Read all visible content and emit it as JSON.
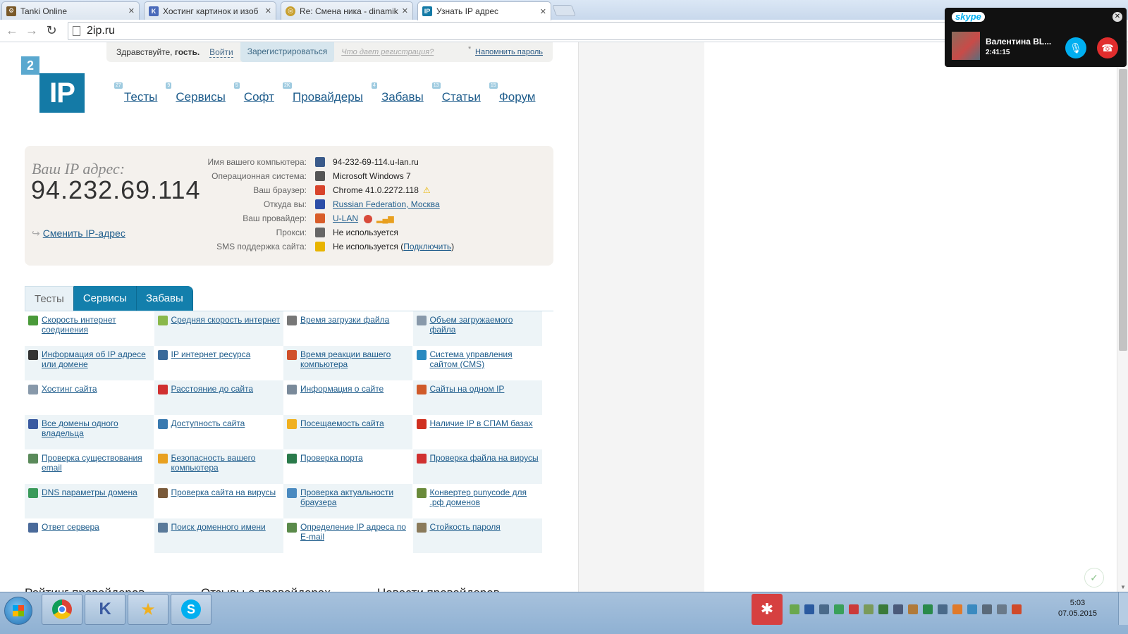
{
  "browser": {
    "tabs": [
      {
        "title": "Tanki Online",
        "icon": "tanki-icon",
        "color": "#7a5a2a"
      },
      {
        "title": "Хостинг картинок и изоб",
        "icon": "hosting-k-icon",
        "color": "#4a6aba"
      },
      {
        "title": "Re: Смена ника - dinamik",
        "icon": "forum-icon",
        "color": "#c8a030"
      },
      {
        "title": "Узнать IP адрес",
        "icon": "ip-favicon",
        "color": "#147aa6"
      }
    ],
    "url": "2ip.ru"
  },
  "site": {
    "greeting_prefix": "Здравствуйте,",
    "greeting_name": "гость.",
    "login": "Войти",
    "register": "Зарегистрироваться",
    "what_register": "Что дает регистрация?",
    "remind": "Напомнить пароль",
    "logo_small": "2",
    "logo_big": "IP",
    "nav": [
      {
        "label": "Тесты",
        "count": "27"
      },
      {
        "label": "Сервисы",
        "count": "9"
      },
      {
        "label": "Софт",
        "count": "5"
      },
      {
        "label": "Провайдеры",
        "count": "2K"
      },
      {
        "label": "Забавы",
        "count": "4"
      },
      {
        "label": "Статьи",
        "count": "13"
      },
      {
        "label": "Форум",
        "count": "15"
      }
    ]
  },
  "ipinfo": {
    "label": "Ваш IP адрес:",
    "ip": "94.232.69.114",
    "change": "Сменить IP-адрес",
    "rows": [
      {
        "key": "Имя вашего компьютера:",
        "value": "94-232-69-114.u-lan.ru",
        "link": false,
        "icon": "computer-icon",
        "color": "#3a5a8a"
      },
      {
        "key": "Операционная система:",
        "value": "Microsoft Windows 7",
        "link": false,
        "icon": "windows-icon",
        "color": "#555555"
      },
      {
        "key": "Ваш браузер:",
        "value": "Chrome 41.0.2272.118",
        "link": false,
        "icon": "chrome-icon",
        "color": "#d8442c",
        "warn": true
      },
      {
        "key": "Откуда вы:",
        "value": "Russian Federation, Москва",
        "link": true,
        "icon": "flag-ru-icon",
        "color": "#2d4ea8"
      },
      {
        "key": "Ваш провайдер:",
        "value": "U-LAN",
        "link": true,
        "icon": "provider-icon",
        "color": "#d85d2a",
        "extras": true
      },
      {
        "key": "Прокси:",
        "value": "Не используется",
        "link": false,
        "icon": "glasses-icon",
        "color": "#666666"
      },
      {
        "key": "SMS поддержка сайта:",
        "value": "Не используется (",
        "link": false,
        "icon": "warning-icon",
        "color": "#e8b400",
        "suffix_link": "Подключить",
        "suffix": ")"
      }
    ]
  },
  "tabs": [
    "Тесты",
    "Сервисы",
    "Забавы"
  ],
  "services": [
    [
      {
        "label": "Скорость интернет соединения",
        "icon": "speed-arrow-icon",
        "color": "#4a9a3a"
      },
      {
        "label": "Средняя скорость интернет",
        "icon": "bars-icon",
        "color": "#8ab84a"
      },
      {
        "label": "Время загрузки файла",
        "icon": "clock-icon",
        "color": "#777777"
      },
      {
        "label": "Объем загружаемого файла",
        "icon": "file-size-icon",
        "color": "#8899aa"
      }
    ],
    [
      {
        "label": "Информация об IP адресе или домене",
        "icon": "ip-badge-icon",
        "color": "#333333"
      },
      {
        "label": "IP интернет ресурса",
        "icon": "ip-globe-icon",
        "color": "#3a6a9a"
      },
      {
        "label": "Время реакции вашего компьютера",
        "icon": "reaction-icon",
        "color": "#d0502a"
      },
      {
        "label": "Система управления сайтом (CMS)",
        "icon": "cms-gear-icon",
        "color": "#2a8ac0"
      }
    ],
    [
      {
        "label": "Хостинг сайта",
        "icon": "server-icon",
        "color": "#8899aa"
      },
      {
        "label": "Расстояние до сайта",
        "icon": "map-pin-icon",
        "color": "#d03030"
      },
      {
        "label": "Информация о сайте",
        "icon": "document-icon",
        "color": "#7a8a9a"
      },
      {
        "label": "Сайты на одном IP",
        "icon": "network-icon",
        "color": "#d05a2a"
      }
    ],
    [
      {
        "label": "Все домены одного владельца",
        "icon": "domains-globe-icon",
        "color": "#3a5aa0"
      },
      {
        "label": "Доступность сайта",
        "icon": "availability-icon",
        "color": "#3a7ab0"
      },
      {
        "label": "Посещаемость сайта",
        "icon": "star-icon",
        "color": "#f0b020"
      },
      {
        "label": "Наличие IP в СПАМ базах",
        "icon": "no-spam-icon",
        "color": "#d03020"
      }
    ],
    [
      {
        "label": "Проверка существования email",
        "icon": "email-check-icon",
        "color": "#5a8a5a"
      },
      {
        "label": "Безопасность вашего компьютера",
        "icon": "lock-icon",
        "color": "#e8a020"
      },
      {
        "label": "Проверка порта",
        "icon": "port-globe-icon",
        "color": "#2a7a4a"
      },
      {
        "label": "Проверка файла на вирусы",
        "icon": "virus-file-icon",
        "color": "#d03030"
      }
    ],
    [
      {
        "label": "DNS параметры домена",
        "icon": "dns-icon",
        "color": "#3a9a5a"
      },
      {
        "label": "Проверка сайта на вирусы",
        "icon": "bug-icon",
        "color": "#7a5a3a"
      },
      {
        "label": "Проверка актуальности браузера",
        "icon": "browser-update-icon",
        "color": "#4a8ac0"
      },
      {
        "label": "Конвертер punycode для .рф доменов",
        "icon": "converter-icon",
        "color": "#6a8a3a"
      }
    ],
    [
      {
        "label": "Ответ сервера",
        "icon": "server-response-icon",
        "color": "#4a6a9a"
      },
      {
        "label": "Поиск доменного имени",
        "icon": "domain-search-icon",
        "color": "#5a7a9a"
      },
      {
        "label": "Определение IP адреса по E-mail",
        "icon": "email-ip-icon",
        "color": "#5a8a4a"
      },
      {
        "label": "Стойкость пароля",
        "icon": "password-icon",
        "color": "#8a7a5a"
      }
    ]
  ],
  "bottom": [
    "Рейтинг провайдеров",
    "Отзывы о провайдерах",
    "Новости провайдеров"
  ],
  "skype": {
    "logo": "skype",
    "caller": "Валентина BL...",
    "duration": "2:41:15"
  },
  "taskbar": {
    "time": "5:03",
    "date": "07.05.2015"
  }
}
